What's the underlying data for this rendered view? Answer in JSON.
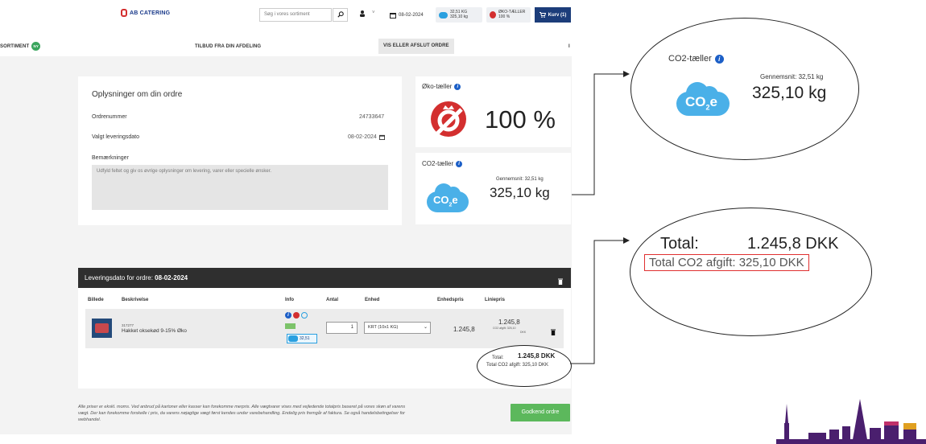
{
  "header": {
    "logo_text": "AB CATERING",
    "search_placeholder": "Søg i vores sortiment",
    "delivery_date": "08-02-2024",
    "co2_chip_line1": "32,51 KG",
    "co2_chip_line2": "325,10 kg",
    "oko_chip_line1": "ØKO-TÆLLER",
    "oko_chip_line2": "100 %",
    "cart_label": "Kurv (1)"
  },
  "nav": {
    "sortiment": "SORTIMENT",
    "ny_badge": "NY",
    "offers": "TILBUD FRA DIN AFDELING",
    "view_order": "VIS ELLER AFSLUT ORDRE",
    "overflow": "I"
  },
  "order_info": {
    "title": "Oplysninger om din ordre",
    "order_number_label": "Ordrenummer",
    "order_number": "24733647",
    "delivery_label": "Valgt leveringsdato",
    "delivery_value": "08-02-2024",
    "remarks_label": "Bemærkninger",
    "remarks_placeholder": "Udfyld feltet og giv os øvrige oplysninger om levering, varer eller specielle ønsker."
  },
  "oko_counter": {
    "title": "Øko-tæller",
    "value": "100 %"
  },
  "co2_counter": {
    "title": "CO2-tæller",
    "average_label": "Gennemsnit: 32,51 kg",
    "value": "325,10 kg",
    "cloud_text": "CO",
    "cloud_sub": "2",
    "cloud_e": "e"
  },
  "table": {
    "header_prefix": "Leveringsdato for ordre:",
    "header_date": "08-02-2024",
    "columns": [
      "Billede",
      "Beskrivelse",
      "Info",
      "Antal",
      "Enhed",
      "Enhedspris",
      "Liniepris"
    ],
    "rows": [
      {
        "sku": "317277",
        "description": "Hakket oksekød 9-15% Øko",
        "co2_badge": "32,51",
        "quantity": "1",
        "unit": "KRT (10x1 KG)",
        "unit_price": "1.245,8",
        "line_price": "1.245,8",
        "line_co2": "CO2 afgift: 325,10",
        "line_co2_unit": "DKK"
      }
    ],
    "total_label": "Total:",
    "total_value": "1.245,8 DKK",
    "total_co2": "Total CO2 afgift: 325,10 DKK"
  },
  "footer": {
    "note": "Alle priser er ekskl. moms. Ved anbrud på kartoner eller kasser kan forekomme merpris. Alle vægtvarer vises med vejledende totalpris baseret på vores skøn af varens vægt. Der kan forekomme forskelle i pris, da varens nøjagtige vægt først kendes under varebehandling. Endelig pris fremgår af faktura. Se også handelsbetingelser for webhandel.",
    "approve_button": "Godkend ordre"
  },
  "callouts": {
    "co2_zoom": {
      "title": "CO2-tæller",
      "average_label": "Gennemsnit: 32,51 kg",
      "value": "325,10 kg"
    },
    "total_zoom": {
      "total_label": "Total:",
      "total_value": "1.245,8 DKK",
      "co2_line": "Total CO2 afgift: 325,10 DKK"
    }
  },
  "colors": {
    "brand_navy": "#1c3d7a",
    "oko_red": "#d32f2f",
    "co2_blue": "#4ab0e8",
    "approve_green": "#5cb85c",
    "highlight_red": "#e03030"
  }
}
